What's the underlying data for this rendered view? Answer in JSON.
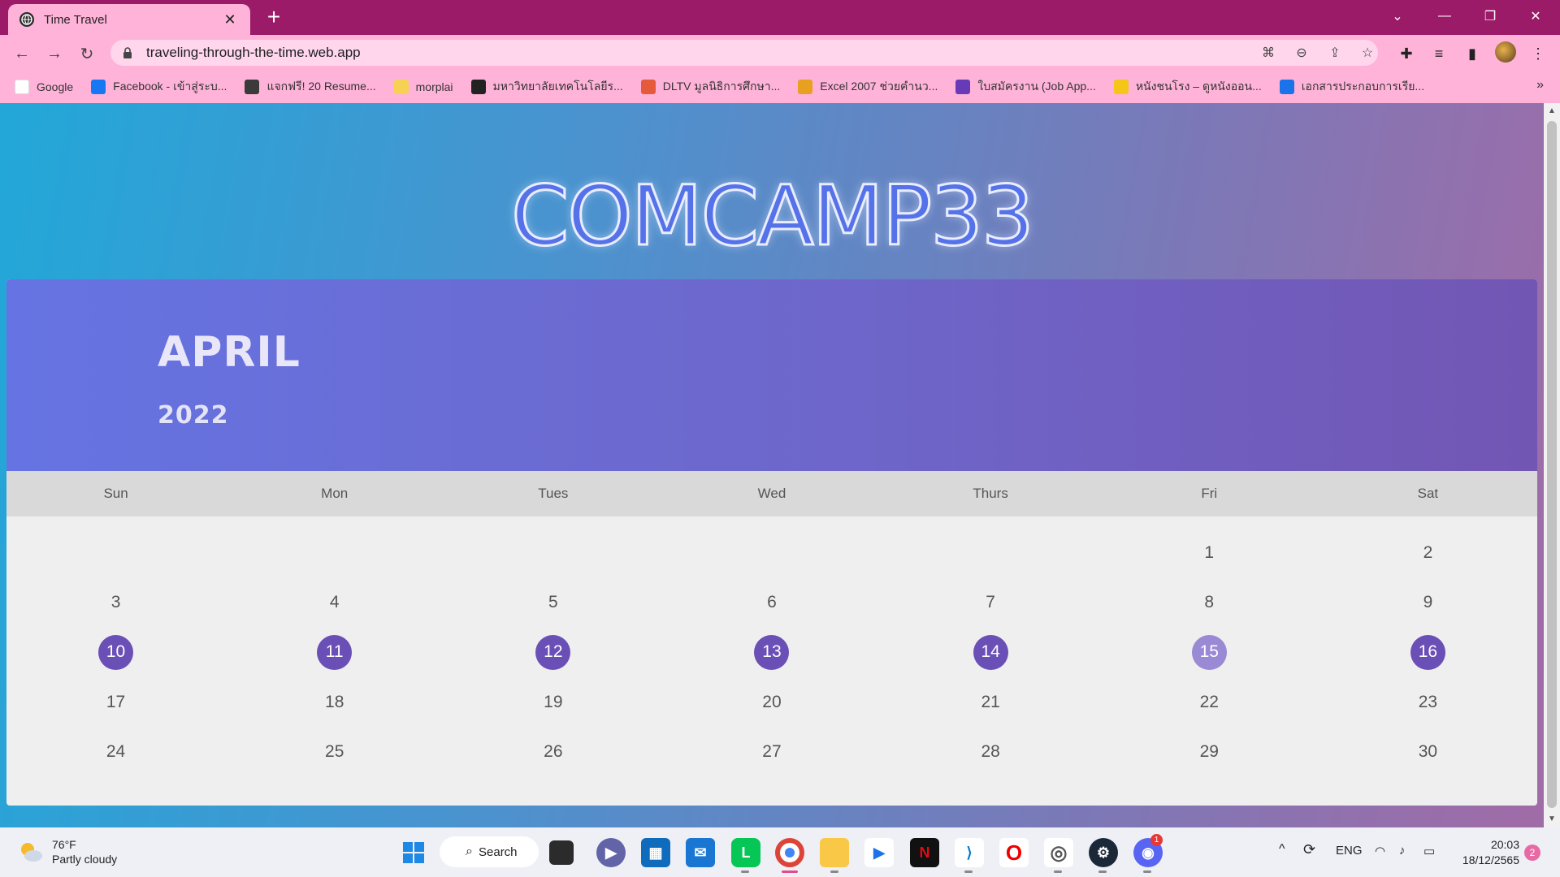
{
  "browser": {
    "tab_title": "Time Travel",
    "url": "traveling-through-the-time.web.app",
    "bookmarks": [
      {
        "label": "Google",
        "color": "#ffffff",
        "icon": "google-icon"
      },
      {
        "label": "Facebook - เข้าสู่ระบ...",
        "color": "#1877f2",
        "icon": "facebook-icon"
      },
      {
        "label": "แจกฟรี! 20 Resume...",
        "color": "#3a3a3a",
        "icon": "panda-icon"
      },
      {
        "label": "morplai",
        "color": "#f7d154",
        "icon": "folder-icon"
      },
      {
        "label": "มหาวิทยาลัยเทคโนโลยีร...",
        "color": "#222222",
        "icon": "globe-icon"
      },
      {
        "label": "DLTV มูลนิธิการศึกษา...",
        "color": "#e45a3b",
        "icon": "dltv-icon"
      },
      {
        "label": "Excel 2007 ช่วยคำนว...",
        "color": "#e8a020",
        "icon": "slides-icon"
      },
      {
        "label": "ใบสมัครงาน (Job App...",
        "color": "#673ab7",
        "icon": "forms-icon"
      },
      {
        "label": "หนังชนโรง – ดูหนังออน...",
        "color": "#f5c518",
        "icon": "star-icon"
      },
      {
        "label": "เอกสารประกอบการเรีย...",
        "color": "#1a73e8",
        "icon": "page-icon"
      }
    ]
  },
  "page": {
    "brand": "COMCAMP33",
    "month": "APRIL",
    "year": "2022",
    "weekdays": [
      "Sun",
      "Mon",
      "Tues",
      "Wed",
      "Thurs",
      "Fri",
      "Sat"
    ],
    "leading_blanks": 5,
    "days_in_month": 30,
    "highlighted_days": [
      10,
      11,
      12,
      13,
      14,
      16
    ],
    "soft_highlighted_days": [
      15
    ]
  },
  "taskbar": {
    "temperature": "76°F",
    "weather": "Partly cloudy",
    "search_label": "Search",
    "language": "ENG",
    "time": "20:03",
    "date": "18/12/2565",
    "notification_count": "2",
    "discord_badge": "1"
  }
}
